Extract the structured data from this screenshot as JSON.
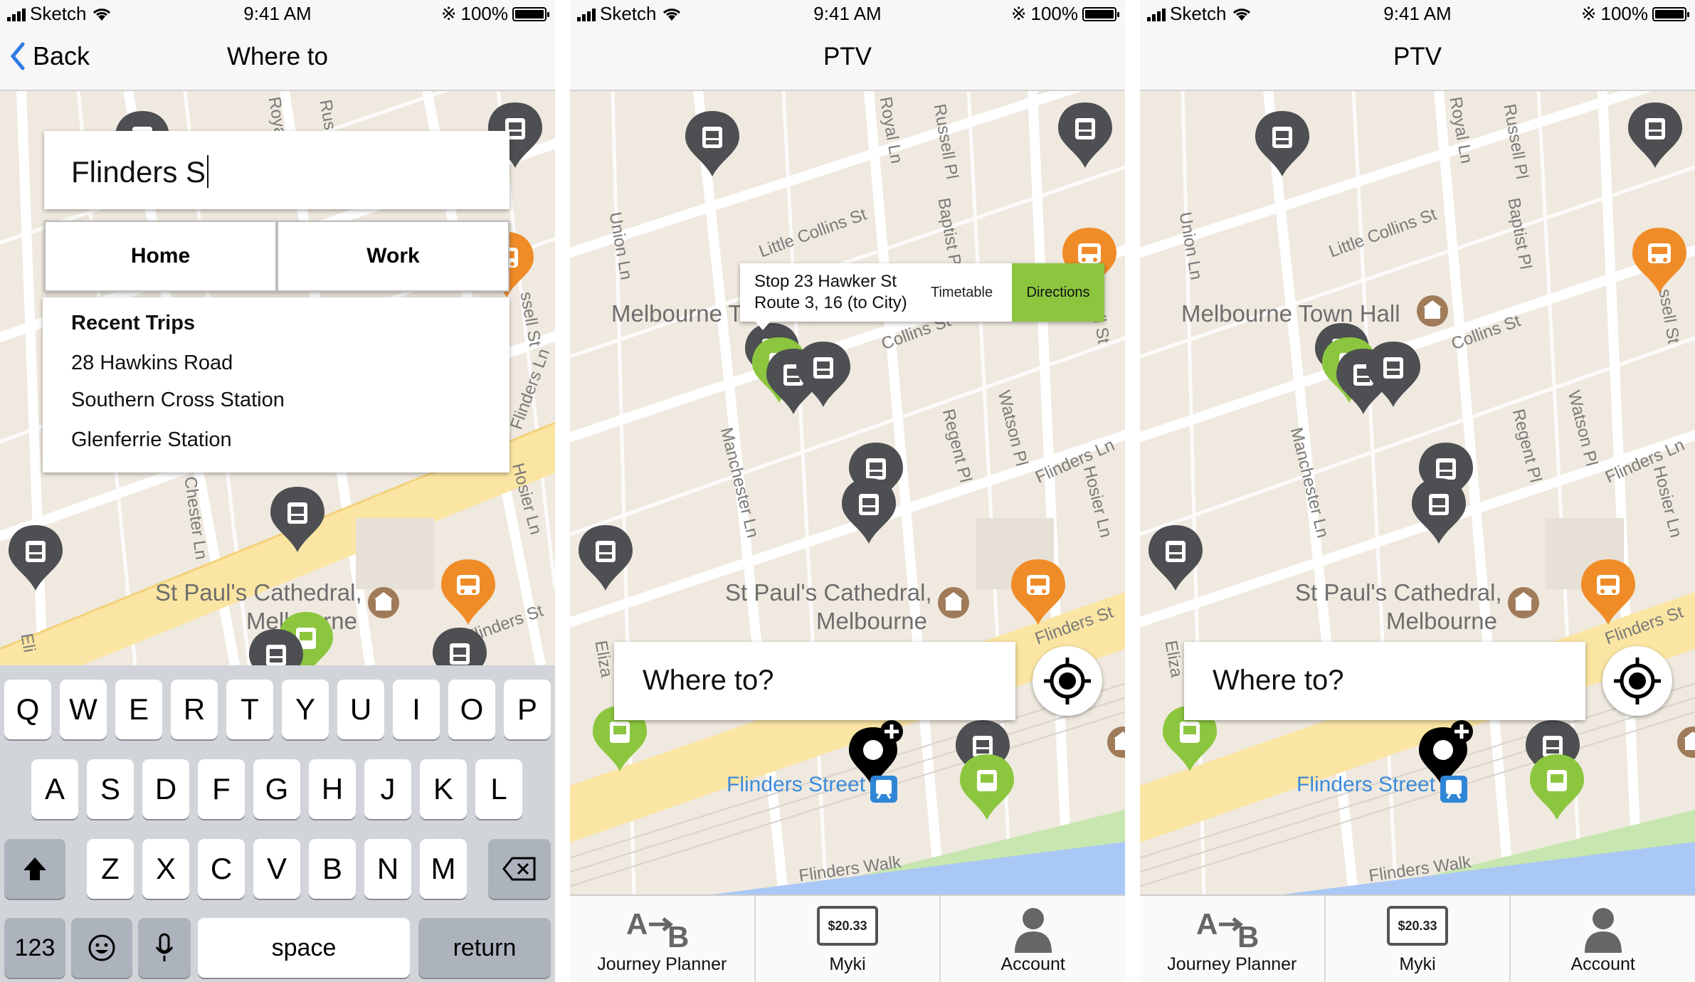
{
  "status_bar": {
    "carrier": "Sketch",
    "time": "9:41 AM",
    "battery": "100%"
  },
  "screen1": {
    "back_label": "Back",
    "title": "Where to",
    "search_value": "Flinders S",
    "home_label": "Home",
    "work_label": "Work",
    "recent_title": "Recent Trips",
    "recent_items": [
      "28 Hawkins Road",
      "Southern Cross Station",
      "Glenferrie Station"
    ],
    "keyboard": {
      "row1": [
        "Q",
        "W",
        "E",
        "R",
        "T",
        "Y",
        "U",
        "I",
        "O",
        "P"
      ],
      "row2": [
        "A",
        "S",
        "D",
        "F",
        "G",
        "H",
        "J",
        "K",
        "L"
      ],
      "row3": [
        "Z",
        "X",
        "C",
        "V",
        "B",
        "N",
        "M"
      ],
      "numbers_label": "123",
      "space_label": "space",
      "return_label": "return"
    }
  },
  "screen2": {
    "title": "PTV",
    "tooltip": {
      "line1": "Stop 23 Hawker St",
      "line2": "Route 3, 16  (to City)",
      "timetable_label": "Timetable",
      "directions_label": "Directions"
    },
    "where_to_placeholder": "Where to?"
  },
  "screen3": {
    "title": "PTV",
    "where_to_placeholder": "Where to?"
  },
  "map_labels": {
    "town_hall": "Melbourne Town Hall",
    "cathedral_1": "St Paul's Cathedral,",
    "cathedral_2": "Melbourne",
    "flinders_street_station": "Flinders Street",
    "little_collins": "Little Collins St",
    "collins": "Collins St",
    "flinders_ln": "Flinders Ln",
    "flinders_st": "Flinders St",
    "flinders_walk": "Flinders Walk",
    "union_ln": "Union Ln",
    "royal_ln": "Royal Ln",
    "russell_pl": "Russell Pl",
    "baptist_pl": "Baptist Pl",
    "manchester_ln": "Manchester Ln",
    "regent_pl": "Regent Pl",
    "watson_pl": "Watson Pl",
    "hosier_ln": "Hosier Ln",
    "russell_st": "Russell St",
    "chester_ln": "Chester Ln",
    "royal_short": "Roya",
    "russ_short": "Rus",
    "eliza_short": "Eliza",
    "elizabeth_short": "Eli",
    "ssell_short": "ssell St",
    "collins_frag": "llins"
  },
  "tabs": [
    {
      "label": "Journey Planner",
      "icon": "journey-planner-icon"
    },
    {
      "label": "Myki",
      "icon": "myki-card-icon",
      "card_value": "$20.33"
    },
    {
      "label": "Account",
      "icon": "account-icon"
    }
  ],
  "colors": {
    "tram_pin": "#8cc63f",
    "stop_pin": "#4d4f52",
    "bus_pin": "#f08c28",
    "directions_button": "#8cc63f",
    "map_land": "#efe9df",
    "map_road": "#ffffff",
    "map_main_road": "#fbe5a3",
    "river": "#a9c8f5",
    "park": "#c8e6b0"
  }
}
